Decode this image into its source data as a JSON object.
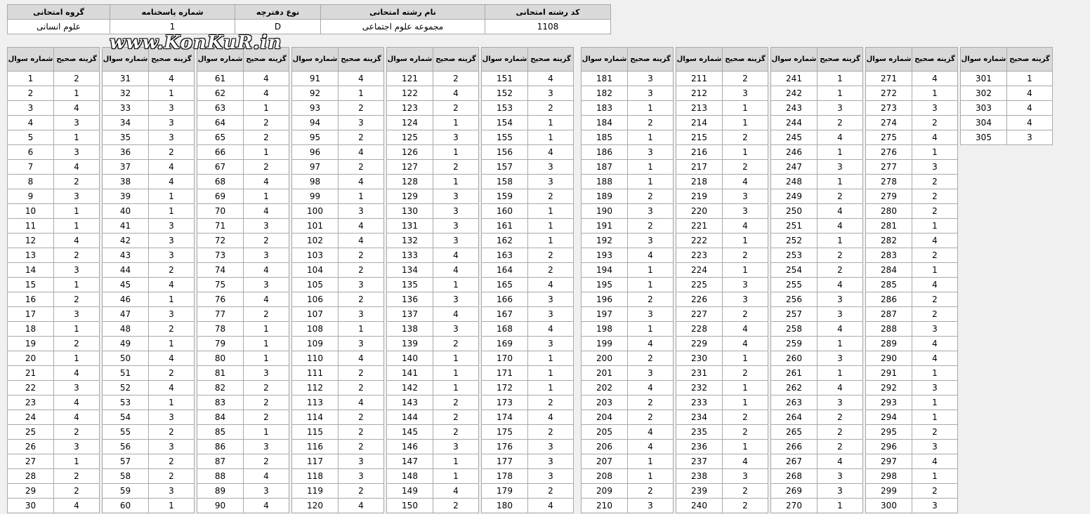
{
  "header": {
    "columns": [
      "گروه امتحانی",
      "شماره پاسخنامه",
      "نوع دفترچه",
      "نام رشته امتحانی",
      "کد رشته امتحانی"
    ],
    "values": [
      "علوم انسانی",
      "1",
      "D",
      "مجموعه علوم اجتماعی",
      "1108"
    ]
  },
  "watermark": "www.KonKuR.in",
  "answer_table": {
    "answer_header": "گزینه صحیح",
    "question_header": "شماره سوال",
    "blocks": [
      {
        "q": [
          1,
          2,
          3,
          4,
          5,
          6,
          7,
          8,
          9,
          10,
          11,
          12,
          13,
          14,
          15,
          16,
          17,
          18,
          19,
          20,
          21,
          22,
          23,
          24,
          25,
          26,
          27,
          28,
          29,
          30
        ],
        "a": [
          2,
          1,
          4,
          3,
          1,
          3,
          4,
          2,
          3,
          1,
          1,
          4,
          2,
          3,
          1,
          2,
          3,
          1,
          2,
          1,
          4,
          3,
          4,
          4,
          2,
          3,
          1,
          2,
          2,
          4
        ]
      },
      {
        "q": [
          31,
          32,
          33,
          34,
          35,
          36,
          37,
          38,
          39,
          40,
          41,
          42,
          43,
          44,
          45,
          46,
          47,
          48,
          49,
          50,
          51,
          52,
          53,
          54,
          55,
          56,
          57,
          58,
          59,
          60
        ],
        "a": [
          4,
          1,
          3,
          3,
          3,
          2,
          4,
          4,
          1,
          1,
          3,
          3,
          3,
          2,
          4,
          1,
          3,
          2,
          1,
          4,
          2,
          4,
          1,
          3,
          2,
          3,
          2,
          2,
          3,
          1
        ]
      },
      {
        "q": [
          61,
          62,
          63,
          64,
          65,
          66,
          67,
          68,
          69,
          70,
          71,
          72,
          73,
          74,
          75,
          76,
          77,
          78,
          79,
          80,
          81,
          82,
          83,
          84,
          85,
          86,
          87,
          88,
          89,
          90
        ],
        "a": [
          4,
          4,
          1,
          2,
          2,
          1,
          2,
          4,
          1,
          4,
          3,
          2,
          3,
          4,
          3,
          4,
          2,
          1,
          1,
          1,
          3,
          2,
          2,
          2,
          1,
          3,
          2,
          4,
          3,
          4
        ]
      },
      {
        "q": [
          91,
          92,
          93,
          94,
          95,
          96,
          97,
          98,
          99,
          100,
          101,
          102,
          103,
          104,
          105,
          106,
          107,
          108,
          109,
          110,
          111,
          112,
          113,
          114,
          115,
          116,
          117,
          118,
          119,
          120
        ],
        "a": [
          4,
          1,
          2,
          3,
          2,
          4,
          2,
          4,
          1,
          3,
          4,
          4,
          2,
          2,
          3,
          2,
          3,
          1,
          3,
          4,
          2,
          2,
          4,
          2,
          2,
          2,
          3,
          3,
          2,
          4
        ]
      },
      {
        "q": [
          121,
          122,
          123,
          124,
          125,
          126,
          127,
          128,
          129,
          130,
          131,
          132,
          133,
          134,
          135,
          136,
          137,
          138,
          139,
          140,
          141,
          142,
          143,
          144,
          145,
          146,
          147,
          148,
          149,
          150
        ],
        "a": [
          2,
          4,
          2,
          1,
          3,
          1,
          2,
          1,
          3,
          3,
          3,
          3,
          4,
          4,
          1,
          3,
          4,
          3,
          2,
          1,
          1,
          1,
          2,
          2,
          2,
          3,
          1,
          1,
          4,
          2
        ]
      },
      {
        "q": [
          151,
          152,
          153,
          154,
          155,
          156,
          157,
          158,
          159,
          160,
          161,
          162,
          163,
          164,
          165,
          166,
          167,
          168,
          169,
          170,
          171,
          172,
          173,
          174,
          175,
          176,
          177,
          178,
          179,
          180
        ],
        "a": [
          4,
          3,
          2,
          1,
          1,
          4,
          3,
          3,
          2,
          1,
          1,
          1,
          2,
          2,
          4,
          3,
          3,
          4,
          3,
          1,
          1,
          1,
          2,
          4,
          2,
          3,
          3,
          3,
          2,
          4
        ]
      },
      {
        "q": [
          181,
          182,
          183,
          184,
          185,
          186,
          187,
          188,
          189,
          190,
          191,
          192,
          193,
          194,
          195,
          196,
          197,
          198,
          199,
          200,
          201,
          202,
          203,
          204,
          205,
          206,
          207,
          208,
          209,
          210
        ],
        "a": [
          3,
          3,
          1,
          2,
          1,
          3,
          1,
          1,
          2,
          3,
          2,
          3,
          4,
          1,
          1,
          2,
          3,
          1,
          4,
          2,
          3,
          4,
          2,
          2,
          4,
          4,
          1,
          1,
          2,
          3
        ]
      },
      {
        "q": [
          211,
          212,
          213,
          214,
          215,
          216,
          217,
          218,
          219,
          220,
          221,
          222,
          223,
          224,
          225,
          226,
          227,
          228,
          229,
          230,
          231,
          232,
          233,
          234,
          235,
          236,
          237,
          238,
          239,
          240
        ],
        "a": [
          2,
          3,
          1,
          1,
          2,
          1,
          2,
          4,
          3,
          3,
          4,
          1,
          2,
          1,
          3,
          3,
          2,
          4,
          4,
          1,
          2,
          1,
          1,
          2,
          2,
          1,
          4,
          3,
          2,
          2
        ]
      },
      {
        "q": [
          241,
          242,
          243,
          244,
          245,
          246,
          247,
          248,
          249,
          250,
          251,
          252,
          253,
          254,
          255,
          256,
          257,
          258,
          259,
          260,
          261,
          262,
          263,
          264,
          265,
          266,
          267,
          268,
          269,
          270
        ],
        "a": [
          1,
          1,
          3,
          2,
          4,
          1,
          3,
          1,
          2,
          4,
          4,
          1,
          2,
          2,
          4,
          3,
          3,
          4,
          1,
          3,
          1,
          4,
          3,
          2,
          2,
          2,
          4,
          3,
          3,
          1
        ]
      },
      {
        "q": [
          271,
          272,
          273,
          274,
          275,
          276,
          277,
          278,
          279,
          280,
          281,
          282,
          283,
          284,
          285,
          286,
          287,
          288,
          289,
          290,
          291,
          292,
          293,
          294,
          295,
          296,
          297,
          298,
          299,
          300
        ],
        "a": [
          4,
          1,
          3,
          2,
          4,
          1,
          3,
          2,
          2,
          2,
          1,
          4,
          2,
          1,
          4,
          2,
          2,
          3,
          4,
          4,
          1,
          3,
          1,
          1,
          2,
          3,
          4,
          1,
          2,
          3
        ]
      },
      {
        "q": [
          301,
          302,
          303,
          304,
          305
        ],
        "a": [
          1,
          4,
          4,
          4,
          3
        ]
      }
    ]
  }
}
